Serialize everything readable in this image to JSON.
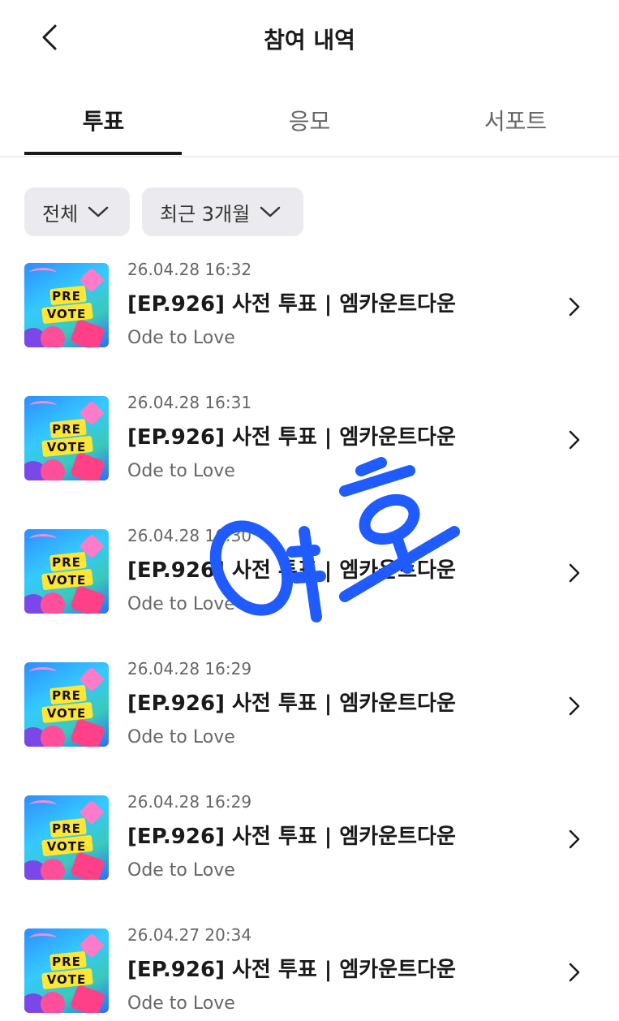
{
  "header": {
    "title": "참여 내역"
  },
  "tabs": [
    {
      "label": "투표"
    },
    {
      "label": "응모"
    },
    {
      "label": "서포트"
    }
  ],
  "filters": [
    {
      "label": "전체"
    },
    {
      "label": "최근 3개월"
    }
  ],
  "thumbnail": {
    "line1": "PRE",
    "line2": "VOTE"
  },
  "items": [
    {
      "date": "26.04.28 16:32",
      "title": "[EP.926] 사전 투표 | 엠카운트다운",
      "subtitle": "Ode to Love"
    },
    {
      "date": "26.04.28 16:31",
      "title": "[EP.926] 사전 투표 | 엠카운트다운",
      "subtitle": "Ode to Love"
    },
    {
      "date": "26.04.28 16:30",
      "title": "[EP.926] 사전 투표 | 엠카운트다운",
      "subtitle": "Ode to Love"
    },
    {
      "date": "26.04.28 16:29",
      "title": "[EP.926] 사전 투표 | 엠카운트다운",
      "subtitle": "Ode to Love"
    },
    {
      "date": "26.04.28 16:29",
      "title": "[EP.926] 사전 투표 | 엠카운트다운",
      "subtitle": "Ode to Love"
    },
    {
      "date": "26.04.27 20:34",
      "title": "[EP.926] 사전 투표 | 엠카운트다운",
      "subtitle": "Ode to Love"
    }
  ],
  "handwriting": {
    "text": "야호",
    "color": "#1f5bff"
  },
  "colors": {
    "accent": "#1a1a1a",
    "filter_bg": "#ebebef",
    "muted_text": "#666666"
  }
}
